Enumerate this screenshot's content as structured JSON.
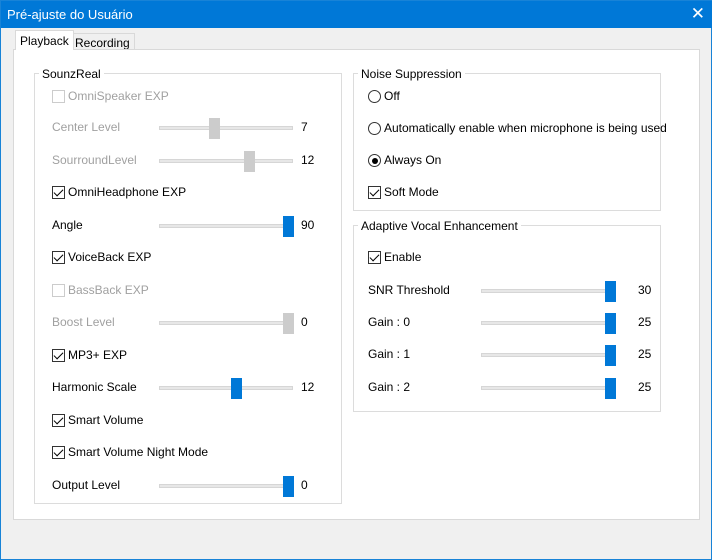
{
  "window": {
    "title": "Pré-ajuste do Usuário",
    "close_icon": "close-icon",
    "accent": "#0078d7"
  },
  "tabs": [
    {
      "label": "Playback",
      "active": true
    },
    {
      "label": "Recording",
      "active": false
    }
  ],
  "sounzreal": {
    "title": "SounzReal",
    "rows": [
      {
        "type": "checkbox",
        "label": "OmniSpeaker EXP",
        "checked": false,
        "disabled": true
      },
      {
        "type": "slider",
        "label": "Center Level",
        "value": "7",
        "position": 0.4,
        "disabled": true
      },
      {
        "type": "slider",
        "label": "SourroundLevel",
        "value": "12",
        "position": 0.68,
        "disabled": true
      },
      {
        "type": "checkbox",
        "label": "OmniHeadphone EXP",
        "checked": true,
        "disabled": false
      },
      {
        "type": "slider",
        "label": "Angle",
        "value": "90",
        "position": 1.0,
        "disabled": false
      },
      {
        "type": "checkbox",
        "label": "VoiceBack EXP",
        "checked": true,
        "disabled": false
      },
      {
        "type": "checkbox",
        "label": "BassBack EXP",
        "checked": false,
        "disabled": true
      },
      {
        "type": "slider",
        "label": "Boost Level",
        "value": "0",
        "position": 1.0,
        "disabled": true
      },
      {
        "type": "checkbox",
        "label": "MP3+ EXP",
        "checked": true,
        "disabled": false
      },
      {
        "type": "slider",
        "label": "Harmonic Scale",
        "value": "12",
        "position": 0.58,
        "disabled": false
      },
      {
        "type": "checkbox",
        "label": "Smart Volume",
        "checked": true,
        "disabled": false
      },
      {
        "type": "checkbox",
        "label": "Smart Volume Night Mode",
        "checked": true,
        "disabled": false
      },
      {
        "type": "slider",
        "label": "Output Level",
        "value": "0",
        "position": 1.0,
        "disabled": false
      }
    ]
  },
  "noise": {
    "title": "Noise Suppression",
    "rows": [
      {
        "type": "radio",
        "label": "Off",
        "checked": false
      },
      {
        "type": "radio",
        "label": "Automatically enable when microphone is being used",
        "checked": false
      },
      {
        "type": "radio",
        "label": "Always On",
        "checked": true
      },
      {
        "type": "checkbox",
        "label": "Soft Mode",
        "checked": true
      }
    ]
  },
  "ave": {
    "title": "Adaptive Vocal Enhancement",
    "rows": [
      {
        "type": "checkbox",
        "label": "Enable",
        "checked": true
      },
      {
        "type": "slider",
        "label": "SNR Threshold",
        "value": "30",
        "position": 1.0
      },
      {
        "type": "slider",
        "label": "Gain : 0",
        "value": "25",
        "position": 1.0
      },
      {
        "type": "slider",
        "label": "Gain : 1",
        "value": "25",
        "position": 1.0
      },
      {
        "type": "slider",
        "label": "Gain : 2",
        "value": "25",
        "position": 1.0
      }
    ]
  }
}
